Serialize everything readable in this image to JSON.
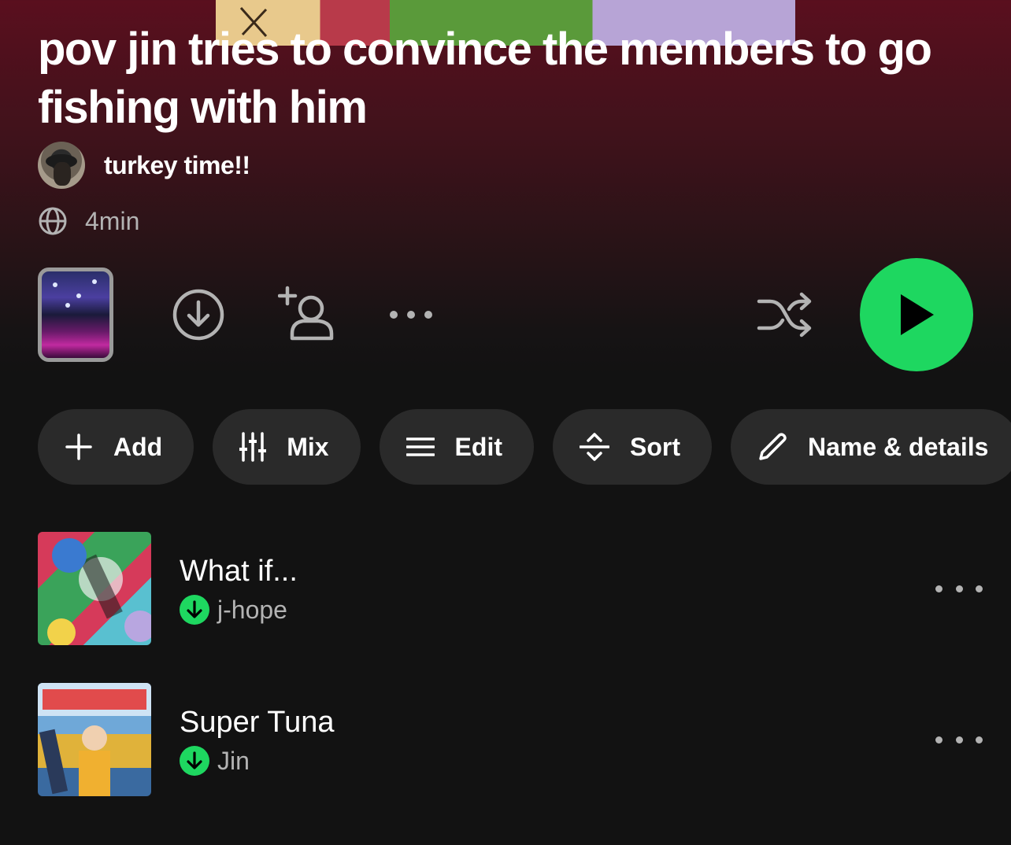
{
  "playlist": {
    "title": "pov jin tries to convince the members to go fishing with him",
    "owner": "turkey time!!",
    "visibility_icon": "globe-icon",
    "duration": "4min"
  },
  "actions": {
    "cover_thumbnail": "playlist-cover-thumbnail",
    "download_icon": "download-circle-icon",
    "add_user_icon": "add-user-icon",
    "more_icon": "more-horizontal-icon",
    "shuffle_icon": "shuffle-icon",
    "play_icon": "play-icon",
    "accent_color": "#1ed760"
  },
  "chips": [
    {
      "label": "Add",
      "icon": "plus-icon"
    },
    {
      "label": "Mix",
      "icon": "sliders-icon"
    },
    {
      "label": "Edit",
      "icon": "list-icon"
    },
    {
      "label": "Sort",
      "icon": "sort-icon"
    },
    {
      "label": "Name & details",
      "icon": "pencil-icon"
    }
  ],
  "tracks": [
    {
      "title": "What if...",
      "artist": "j-hope",
      "downloaded": true
    },
    {
      "title": "Super Tuna",
      "artist": "Jin",
      "downloaded": true
    }
  ],
  "colors": {
    "background": "#121212",
    "header_tint": "#5a0f1e",
    "chip_bg": "#2a2a2a",
    "secondary_text": "#b3b3b3"
  }
}
